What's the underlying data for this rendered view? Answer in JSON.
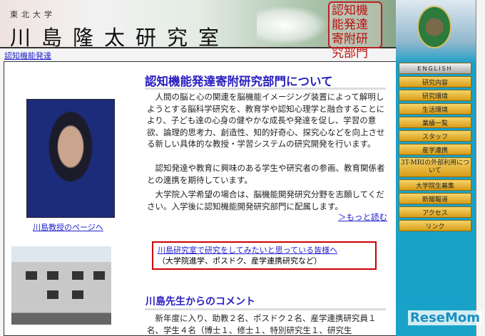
{
  "header": {
    "university": "東北大学",
    "lab_name": "川島隆太研究室",
    "stamp_text": "認知機能発達寄附研究部門"
  },
  "breadcrumb": "認知機能発達",
  "menu": [
    {
      "label": "ENGLISH"
    },
    {
      "label": "研究内容"
    },
    {
      "label": "研究環境"
    },
    {
      "label": "生活環境"
    },
    {
      "label": "業績一覧"
    },
    {
      "label": "スタッフ"
    },
    {
      "label": "産学連携"
    },
    {
      "label": "3T-MRIの外部利用について"
    },
    {
      "label": "大学院生募集"
    },
    {
      "label": "新聞報道"
    },
    {
      "label": "アクセス"
    },
    {
      "label": "リンク"
    }
  ],
  "left": {
    "professor_link": "川島教授のページへ"
  },
  "main": {
    "title": "認知機能発達寄附研究部門について",
    "paragraphs": [
      "人間の脳と心の関連を脳機能イメージング装置によって解明しようとする脳科学研究を、教育学や認知心理学と融合することにより、子ども達の心身の健やかな成長や発達を促し、学習の意欲、論理的思考力、創造性、知的好奇心、探究心などを向上させる新しい具体的な教授・学習システムの研究開発を行います。",
      "認知発達や教育に興味のある学生や研究者の参画、教育関係者との連携を期待しています。",
      "大学院入学希望の場合は、脳機能開発研究分野を志願してください。入学後に認知機能開発研究部門に配属します。"
    ],
    "more_link": "＞もっと読む",
    "recruit_link": "川島研究室で研究をしてみたいと思っている皆様へ",
    "recruit_note": "（大学院進学、ポスドク、産学連携研究など）",
    "comment_title": "川島先生からのコメント",
    "comment_text": "新年度に入り、助教２名、ポスドク２名、産学連携研究員１名、学生４名（博士１、修士１、特別研究生１、研究生"
  },
  "watermark": "ReseMom"
}
